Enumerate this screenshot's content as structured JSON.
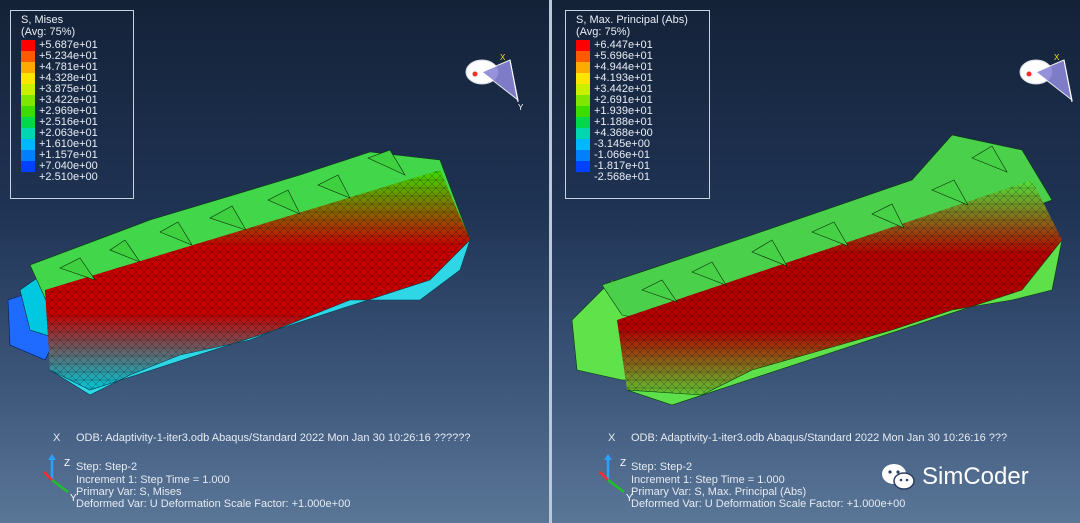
{
  "left": {
    "legend": {
      "title_line1": "S, Mises",
      "title_line2": "(Avg: 75%)",
      "entries": [
        "+5.687e+01",
        "+5.234e+01",
        "+4.781e+01",
        "+4.328e+01",
        "+3.875e+01",
        "+3.422e+01",
        "+2.969e+01",
        "+2.516e+01",
        "+2.063e+01",
        "+1.610e+01",
        "+1.157e+01",
        "+7.040e+00",
        "+2.510e+00"
      ]
    },
    "info": {
      "odb_line": "ODB: Adaptivity-1-iter3.odb    Abaqus/Standard 2022    Mon Jan 30 10:26:16 ??????",
      "step": "Step: Step-2",
      "increment": "Increment      1: Step Time =    1.000",
      "primary": "Primary Var: S, Mises",
      "deformed": "Deformed Var: U   Deformation Scale Factor: +1.000e+00"
    }
  },
  "right": {
    "legend": {
      "title_line1": "S, Max. Principal (Abs)",
      "title_line2": "(Avg: 75%)",
      "entries": [
        "+6.447e+01",
        "+5.696e+01",
        "+4.944e+01",
        "+4.193e+01",
        "+3.442e+01",
        "+2.691e+01",
        "+1.939e+01",
        "+1.188e+01",
        "+4.368e+00",
        "-3.145e+00",
        "-1.066e+01",
        "-1.817e+01",
        "-2.568e+01"
      ]
    },
    "info": {
      "odb_line": "ODB: Adaptivity-1-iter3.odb    Abaqus/Standard 2022    Mon Jan 30 10:26:16 ???",
      "step": "Step: Step-2",
      "increment": "Increment      1: Step Time =    1.000",
      "primary": "Primary Var: S, Max. Principal (Abs)",
      "deformed": "Deformed Var: U   Deformation Scale Factor: +1.000e+00"
    }
  },
  "legend_colors": [
    "#ff0000",
    "#ff5a00",
    "#ffaa00",
    "#ffe600",
    "#c8f000",
    "#7ee600",
    "#3ddc00",
    "#00d84a",
    "#00d6b0",
    "#00b8ff",
    "#0080ff",
    "#0040ff",
    "#0000ff"
  ],
  "axes": {
    "x": "X",
    "y": "Y",
    "z": "Z"
  },
  "watermark": {
    "brand": "SimCoder",
    "icon": "wechat-icon"
  }
}
